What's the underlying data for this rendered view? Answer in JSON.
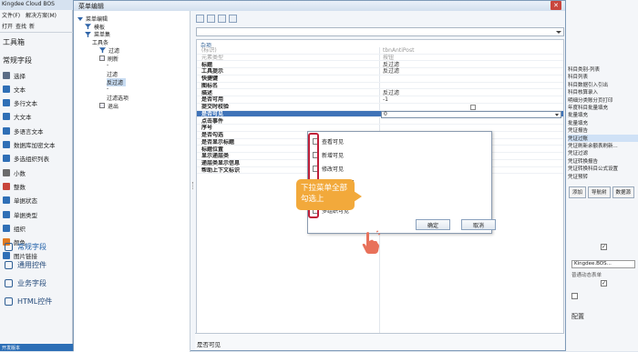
{
  "left_app": {
    "title": "Kingdee Cloud BOS",
    "menu": [
      "文件(F)",
      "解决方案(M)"
    ],
    "toolbar": [
      "打开",
      "查找",
      "新"
    ],
    "toolbox_title": "工具箱",
    "common_fields_header": "常规字段",
    "items": [
      {
        "label": "选择",
        "icon": "pointer-icon",
        "color": "#5b6d86"
      },
      {
        "label": "文本",
        "icon": "text-icon",
        "color": "#2f6fb6"
      },
      {
        "label": "多行文本",
        "icon": "multiline-text-icon",
        "color": "#2f6fb6"
      },
      {
        "label": "大文本",
        "icon": "large-text-icon",
        "color": "#2f6fb6"
      },
      {
        "label": "多语言文本",
        "icon": "multilang-text-icon",
        "color": "#2f6fb6"
      },
      {
        "label": "数据库加密文本",
        "icon": "encrypted-text-icon",
        "color": "#2f6fb6"
      },
      {
        "label": "多选组织列表",
        "icon": "org-list-icon",
        "color": "#2f6fb6"
      },
      {
        "label": "小数",
        "icon": "decimal-icon",
        "color": "#6b6b6b"
      },
      {
        "label": "整数",
        "icon": "integer-icon",
        "color": "#c8453b"
      },
      {
        "label": "单据状态",
        "icon": "bill-status-icon",
        "color": "#2f6fb6"
      },
      {
        "label": "单据类型",
        "icon": "bill-type-icon",
        "color": "#2f6fb6"
      },
      {
        "label": "组织",
        "icon": "org-icon",
        "color": "#2f6fb6"
      },
      {
        "label": "颜色",
        "icon": "color-icon",
        "color": "#e07b22"
      },
      {
        "label": "图片链接",
        "icon": "picture-icon",
        "color": "#2f6fb6"
      }
    ],
    "categories": [
      {
        "label": "常规字段",
        "icon": "common-fields-icon"
      },
      {
        "label": "通用控件",
        "icon": "common-controls-icon"
      },
      {
        "label": "业务字段",
        "icon": "business-fields-icon"
      },
      {
        "label": "HTML控件",
        "icon": "html-controls-icon"
      }
    ],
    "status": "开发版本"
  },
  "dialog": {
    "title": "菜单编辑",
    "close_glyph": "✕",
    "tree": [
      {
        "label": "菜单编辑",
        "level": 0,
        "type": "root"
      },
      {
        "label": "模板",
        "level": 1,
        "type": "filter"
      },
      {
        "label": "菜单集",
        "level": 1,
        "type": "filter-open"
      },
      {
        "label": "工具条",
        "level": 2,
        "type": "plain"
      },
      {
        "label": "过滤",
        "level": 3,
        "type": "filter"
      },
      {
        "label": "刷新",
        "level": 3,
        "type": "item"
      },
      {
        "label": "-",
        "level": 4,
        "type": "plain"
      },
      {
        "label": "过滤",
        "level": 4,
        "type": "plain"
      },
      {
        "label": "反过滤",
        "level": 4,
        "type": "plain",
        "selected": true
      },
      {
        "label": "-",
        "level": 4,
        "type": "plain"
      },
      {
        "label": "过滤选项",
        "level": 4,
        "type": "plain"
      },
      {
        "label": "退出",
        "level": 3,
        "type": "item"
      }
    ],
    "section": "杂项",
    "properties": [
      {
        "name": "(标识)",
        "value": "tbnAntiPost",
        "disabled": true
      },
      {
        "name": "元素类型",
        "value": "按钮",
        "disabled": true
      },
      {
        "name": "标题",
        "value": "反过滤"
      },
      {
        "name": "工具提示",
        "value": "反过滤"
      },
      {
        "name": "快捷键",
        "value": ""
      },
      {
        "name": "图标名",
        "value": ""
      },
      {
        "name": "描述",
        "value": "反过滤"
      },
      {
        "name": "是否可用",
        "value": "-1"
      },
      {
        "name": "提交时校验",
        "value": "",
        "checkbox": true
      },
      {
        "name": "是否可见",
        "value": "0",
        "selected": true
      },
      {
        "name": "点击事件",
        "value": ""
      },
      {
        "name": "序号",
        "value": ""
      },
      {
        "name": "是否勾选",
        "value": ""
      },
      {
        "name": "是否显示标题",
        "value": ""
      },
      {
        "name": "标题位置",
        "value": ""
      },
      {
        "name": "显示递层类",
        "value": ""
      },
      {
        "name": "递层类显示信息",
        "value": ""
      },
      {
        "name": "帮助上下文标识",
        "value": ""
      }
    ],
    "dropdown_options": [
      "查看可见",
      "新增可见",
      "修改可见",
      "初始加载可见",
      "单体组织可见",
      "多组织可见"
    ],
    "ok_label": "确定",
    "cancel_label": "取消",
    "description": "是否可见"
  },
  "callout": {
    "line1": "下拉菜单全部",
    "line2": "勾选上"
  },
  "right_panel": {
    "items": [
      "科目类别-列表",
      "科目列表",
      "科目数据引入引出",
      "科目核算录入",
      "明细分类账分页打印",
      "年度科目批量填充",
      "批量填充",
      "批量填充",
      "凭证报告",
      "凭证过账",
      "凭证刷新余额表刷新...",
      "凭证过滤",
      "凭证转换报告",
      "凭证转换科目公式设置",
      "凭证预转"
    ],
    "selected_index": 9,
    "buttons": [
      "添加",
      "导航树",
      "数据源"
    ],
    "form_value": "Kingdee.BOS...",
    "form_label": "普通动态表单",
    "config_label": "配置"
  },
  "colors": {
    "accent": "#3f73b8",
    "callout": "#f2a93b",
    "highlight": "#c0203a",
    "hand": "#e8715a"
  }
}
